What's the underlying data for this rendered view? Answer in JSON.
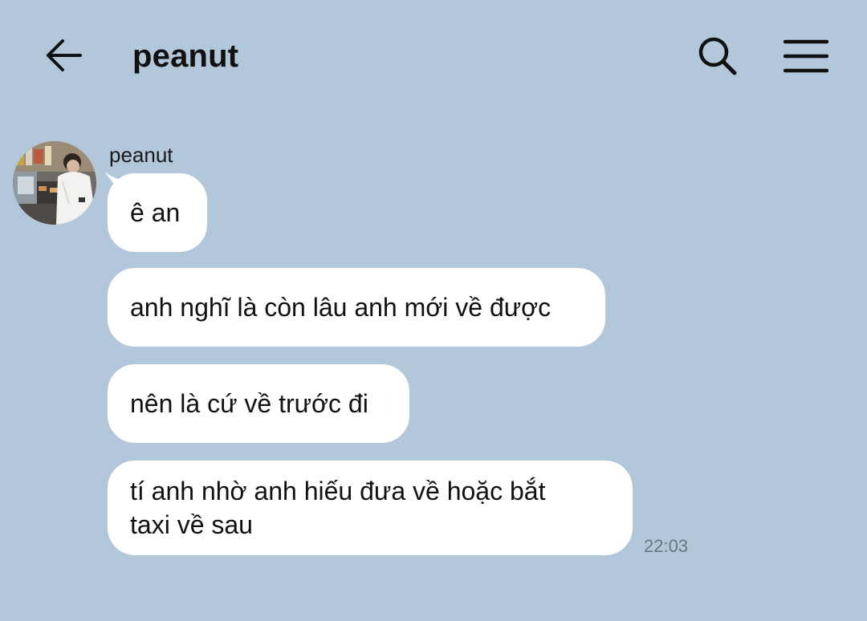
{
  "header": {
    "title": "peanut",
    "back_icon": "arrow-left-icon",
    "search_icon": "search-icon",
    "menu_icon": "hamburger-menu-icon"
  },
  "colors": {
    "background": "#b2c7da",
    "bubble": "#ffffff",
    "timestamp": "#6a7680"
  },
  "conversation": {
    "sender": "peanut",
    "messages": [
      {
        "text": "ê an"
      },
      {
        "text": "anh nghĩ là còn lâu anh mới về được"
      },
      {
        "text": "nên là cứ về trước đi"
      },
      {
        "text": "tí anh nhờ anh hiếu đưa về hoặc bắt\ntaxi về sau"
      }
    ],
    "last_time": "22:03"
  }
}
